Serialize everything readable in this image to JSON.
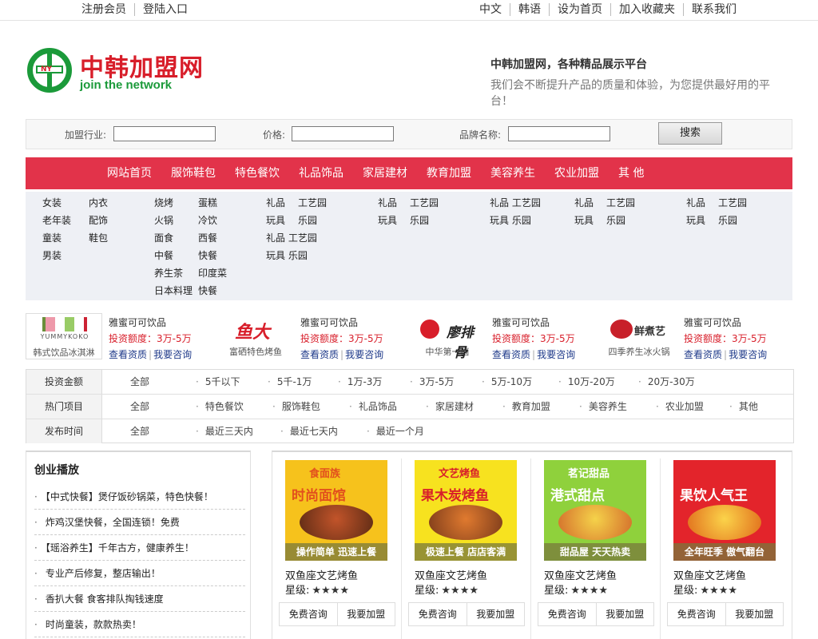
{
  "topbar": {
    "left": [
      "注册会员",
      "登陆入口"
    ],
    "right": [
      "中文",
      "韩语",
      "设为首页",
      "加入收藏夹",
      "联系我们"
    ]
  },
  "logo": {
    "cn": "中韩加盟网",
    "en": "join the network",
    "mark": "NY"
  },
  "slogan": {
    "line1": "中韩加盟网，各种精品展示平台",
    "line2": "我们会不断提升产品的质量和体验，为您提供最好用的平台！"
  },
  "search": {
    "industry_label": "加盟行业:",
    "price_label": "价格:",
    "brand_label": "品牌名称:",
    "industry_value": "",
    "price_value": "",
    "brand_value": "",
    "button": "搜索"
  },
  "nav": [
    "网站首页",
    "服饰鞋包",
    "特色餐饮",
    "礼品饰品",
    "家居建材",
    "教育加盟",
    "美容养生",
    "农业加盟",
    "其 他"
  ],
  "subcats": {
    "c1": [
      "女装",
      "老年装",
      "童装",
      "男装"
    ],
    "c2": [
      "内衣",
      "配饰",
      "鞋包"
    ],
    "c3": [
      "烧烤",
      "火锅",
      "面食",
      "中餐",
      "养生茶",
      "日本料理"
    ],
    "c4": [
      "蛋糕",
      "冷饮",
      "西餐",
      "快餐",
      "印度菜",
      "快餐"
    ],
    "c5": [
      "礼品",
      "玩具",
      "礼品 工艺园",
      "玩具 乐园"
    ],
    "c6": [
      "工艺园",
      "乐园"
    ],
    "c7": [
      "礼品",
      "玩具"
    ],
    "c8": [
      "工艺园",
      "乐园"
    ],
    "c9": [
      "礼品 工艺园",
      "玩具 乐园"
    ],
    "c10": [
      "礼品",
      "玩具"
    ],
    "c11": [
      "工艺园",
      "乐园"
    ],
    "c12": [
      "礼品",
      "玩具"
    ],
    "c13": [
      "工艺园",
      "乐园"
    ]
  },
  "brands": [
    {
      "caption": "韩式饮品冰淇淋",
      "logo_text": "YUMMYKOKO",
      "name": "雅蜜可可饮品",
      "invest_label": "投资额度：",
      "invest_value": "3万-5万",
      "link1": "查看资质",
      "link2": "我要咨询"
    },
    {
      "caption": "富硒特色烤鱼",
      "logo_text": "鱼大",
      "name": "雅蜜可可饮品",
      "invest_label": "投资额度：",
      "invest_value": "3万-5万",
      "link1": "查看资质",
      "link2": "我要咨询"
    },
    {
      "caption": "中华第一卤",
      "logo_text": "廖排骨",
      "name": "雅蜜可可饮品",
      "invest_label": "投资额度：",
      "invest_value": "3万-5万",
      "link1": "查看资质",
      "link2": "我要咨询"
    },
    {
      "caption": "四季养生冰火锅",
      "logo_text": "鲜煮艺",
      "name": "雅蜜可可饮品",
      "invest_label": "投资额度：",
      "invest_value": "3万-5万",
      "link1": "查看资质",
      "link2": "我要咨询"
    }
  ],
  "filter": {
    "rows": [
      {
        "head": "投资金额",
        "all": "全部",
        "options": [
          "5千以下",
          "5千-1万",
          "1万-3万",
          "3万-5万",
          "5万-10万",
          "10万-20万",
          "20万-30万"
        ]
      },
      {
        "head": "热门项目",
        "all": "全部",
        "options": [
          "特色餐饮",
          "服饰鞋包",
          "礼品饰品",
          "家居建材",
          "教育加盟",
          "美容养生",
          "农业加盟",
          "其他"
        ]
      },
      {
        "head": "发布时间",
        "all": "全部",
        "options": [
          "最近三天内",
          "最近七天内",
          "最近一个月"
        ]
      }
    ]
  },
  "news": {
    "title": "创业播放",
    "items": [
      "【中式快餐】煲仔饭砂锅菜，特色快餐！",
      "炸鸡汉堡快餐，全国连锁！免费",
      "【瑶浴养生】千年古方，健康养生！",
      "专业产后修复，整店输出！",
      "香扒大餐 食客排队掏钱速度",
      "时尚童装，款款热卖！"
    ]
  },
  "products": [
    {
      "brand": "食面族",
      "headline": "时尚面馆",
      "tagline": "操作简单 迅速上餐",
      "name": "双鱼座文艺烤鱼",
      "star_label": "星级:",
      "stars": "★★★★",
      "btn1": "免费咨询",
      "btn2": "我要加盟",
      "bg": "#f6c21c",
      "headline_color": "#e2501d"
    },
    {
      "brand": "文艺烤鱼",
      "headline": "果木炭烤鱼",
      "tagline": "极速上餐 店店客满",
      "name": "双鱼座文艺烤鱼",
      "star_label": "星级:",
      "stars": "★★★★",
      "btn1": "免费咨询",
      "btn2": "我要加盟",
      "bg": "#f7e21f",
      "headline_color": "#d81e2a"
    },
    {
      "brand": "茗记甜品",
      "headline": "港式甜点",
      "tagline": "甜品屋 天天热卖",
      "name": "双鱼座文艺烤鱼",
      "star_label": "星级:",
      "stars": "★★★★",
      "btn1": "免费咨询",
      "btn2": "我要加盟",
      "bg": "#8fd13c",
      "headline_color": "#ffffff"
    },
    {
      "brand": "",
      "headline": "果饮人气王",
      "tagline": "全年旺季 傲气翻台",
      "name": "双鱼座文艺烤鱼",
      "star_label": "星级:",
      "stars": "★★★★",
      "btn1": "免费咨询",
      "btn2": "我要加盟",
      "bg": "#e3242b",
      "headline_color": "#ffffff"
    }
  ]
}
